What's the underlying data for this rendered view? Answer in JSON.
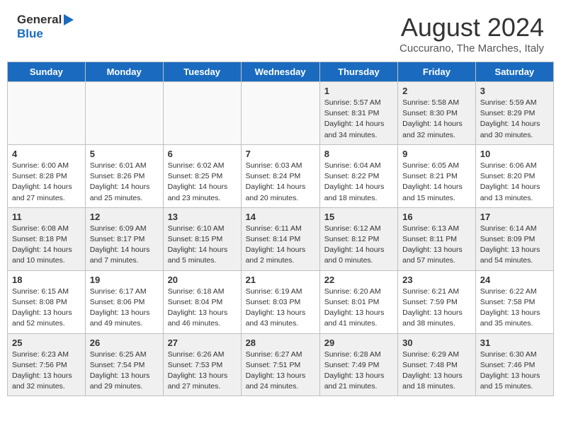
{
  "header": {
    "logo_general": "General",
    "logo_blue": "Blue",
    "month_title": "August 2024",
    "subtitle": "Cuccurano, The Marches, Italy"
  },
  "weekdays": [
    "Sunday",
    "Monday",
    "Tuesday",
    "Wednesday",
    "Thursday",
    "Friday",
    "Saturday"
  ],
  "weeks": [
    [
      {
        "day": "",
        "info": ""
      },
      {
        "day": "",
        "info": ""
      },
      {
        "day": "",
        "info": ""
      },
      {
        "day": "",
        "info": ""
      },
      {
        "day": "1",
        "info": "Sunrise: 5:57 AM\nSunset: 8:31 PM\nDaylight: 14 hours\nand 34 minutes."
      },
      {
        "day": "2",
        "info": "Sunrise: 5:58 AM\nSunset: 8:30 PM\nDaylight: 14 hours\nand 32 minutes."
      },
      {
        "day": "3",
        "info": "Sunrise: 5:59 AM\nSunset: 8:29 PM\nDaylight: 14 hours\nand 30 minutes."
      }
    ],
    [
      {
        "day": "4",
        "info": "Sunrise: 6:00 AM\nSunset: 8:28 PM\nDaylight: 14 hours\nand 27 minutes."
      },
      {
        "day": "5",
        "info": "Sunrise: 6:01 AM\nSunset: 8:26 PM\nDaylight: 14 hours\nand 25 minutes."
      },
      {
        "day": "6",
        "info": "Sunrise: 6:02 AM\nSunset: 8:25 PM\nDaylight: 14 hours\nand 23 minutes."
      },
      {
        "day": "7",
        "info": "Sunrise: 6:03 AM\nSunset: 8:24 PM\nDaylight: 14 hours\nand 20 minutes."
      },
      {
        "day": "8",
        "info": "Sunrise: 6:04 AM\nSunset: 8:22 PM\nDaylight: 14 hours\nand 18 minutes."
      },
      {
        "day": "9",
        "info": "Sunrise: 6:05 AM\nSunset: 8:21 PM\nDaylight: 14 hours\nand 15 minutes."
      },
      {
        "day": "10",
        "info": "Sunrise: 6:06 AM\nSunset: 8:20 PM\nDaylight: 14 hours\nand 13 minutes."
      }
    ],
    [
      {
        "day": "11",
        "info": "Sunrise: 6:08 AM\nSunset: 8:18 PM\nDaylight: 14 hours\nand 10 minutes."
      },
      {
        "day": "12",
        "info": "Sunrise: 6:09 AM\nSunset: 8:17 PM\nDaylight: 14 hours\nand 7 minutes."
      },
      {
        "day": "13",
        "info": "Sunrise: 6:10 AM\nSunset: 8:15 PM\nDaylight: 14 hours\nand 5 minutes."
      },
      {
        "day": "14",
        "info": "Sunrise: 6:11 AM\nSunset: 8:14 PM\nDaylight: 14 hours\nand 2 minutes."
      },
      {
        "day": "15",
        "info": "Sunrise: 6:12 AM\nSunset: 8:12 PM\nDaylight: 14 hours\nand 0 minutes."
      },
      {
        "day": "16",
        "info": "Sunrise: 6:13 AM\nSunset: 8:11 PM\nDaylight: 13 hours\nand 57 minutes."
      },
      {
        "day": "17",
        "info": "Sunrise: 6:14 AM\nSunset: 8:09 PM\nDaylight: 13 hours\nand 54 minutes."
      }
    ],
    [
      {
        "day": "18",
        "info": "Sunrise: 6:15 AM\nSunset: 8:08 PM\nDaylight: 13 hours\nand 52 minutes."
      },
      {
        "day": "19",
        "info": "Sunrise: 6:17 AM\nSunset: 8:06 PM\nDaylight: 13 hours\nand 49 minutes."
      },
      {
        "day": "20",
        "info": "Sunrise: 6:18 AM\nSunset: 8:04 PM\nDaylight: 13 hours\nand 46 minutes."
      },
      {
        "day": "21",
        "info": "Sunrise: 6:19 AM\nSunset: 8:03 PM\nDaylight: 13 hours\nand 43 minutes."
      },
      {
        "day": "22",
        "info": "Sunrise: 6:20 AM\nSunset: 8:01 PM\nDaylight: 13 hours\nand 41 minutes."
      },
      {
        "day": "23",
        "info": "Sunrise: 6:21 AM\nSunset: 7:59 PM\nDaylight: 13 hours\nand 38 minutes."
      },
      {
        "day": "24",
        "info": "Sunrise: 6:22 AM\nSunset: 7:58 PM\nDaylight: 13 hours\nand 35 minutes."
      }
    ],
    [
      {
        "day": "25",
        "info": "Sunrise: 6:23 AM\nSunset: 7:56 PM\nDaylight: 13 hours\nand 32 minutes."
      },
      {
        "day": "26",
        "info": "Sunrise: 6:25 AM\nSunset: 7:54 PM\nDaylight: 13 hours\nand 29 minutes."
      },
      {
        "day": "27",
        "info": "Sunrise: 6:26 AM\nSunset: 7:53 PM\nDaylight: 13 hours\nand 27 minutes."
      },
      {
        "day": "28",
        "info": "Sunrise: 6:27 AM\nSunset: 7:51 PM\nDaylight: 13 hours\nand 24 minutes."
      },
      {
        "day": "29",
        "info": "Sunrise: 6:28 AM\nSunset: 7:49 PM\nDaylight: 13 hours\nand 21 minutes."
      },
      {
        "day": "30",
        "info": "Sunrise: 6:29 AM\nSunset: 7:48 PM\nDaylight: 13 hours\nand 18 minutes."
      },
      {
        "day": "31",
        "info": "Sunrise: 6:30 AM\nSunset: 7:46 PM\nDaylight: 13 hours\nand 15 minutes."
      }
    ]
  ]
}
